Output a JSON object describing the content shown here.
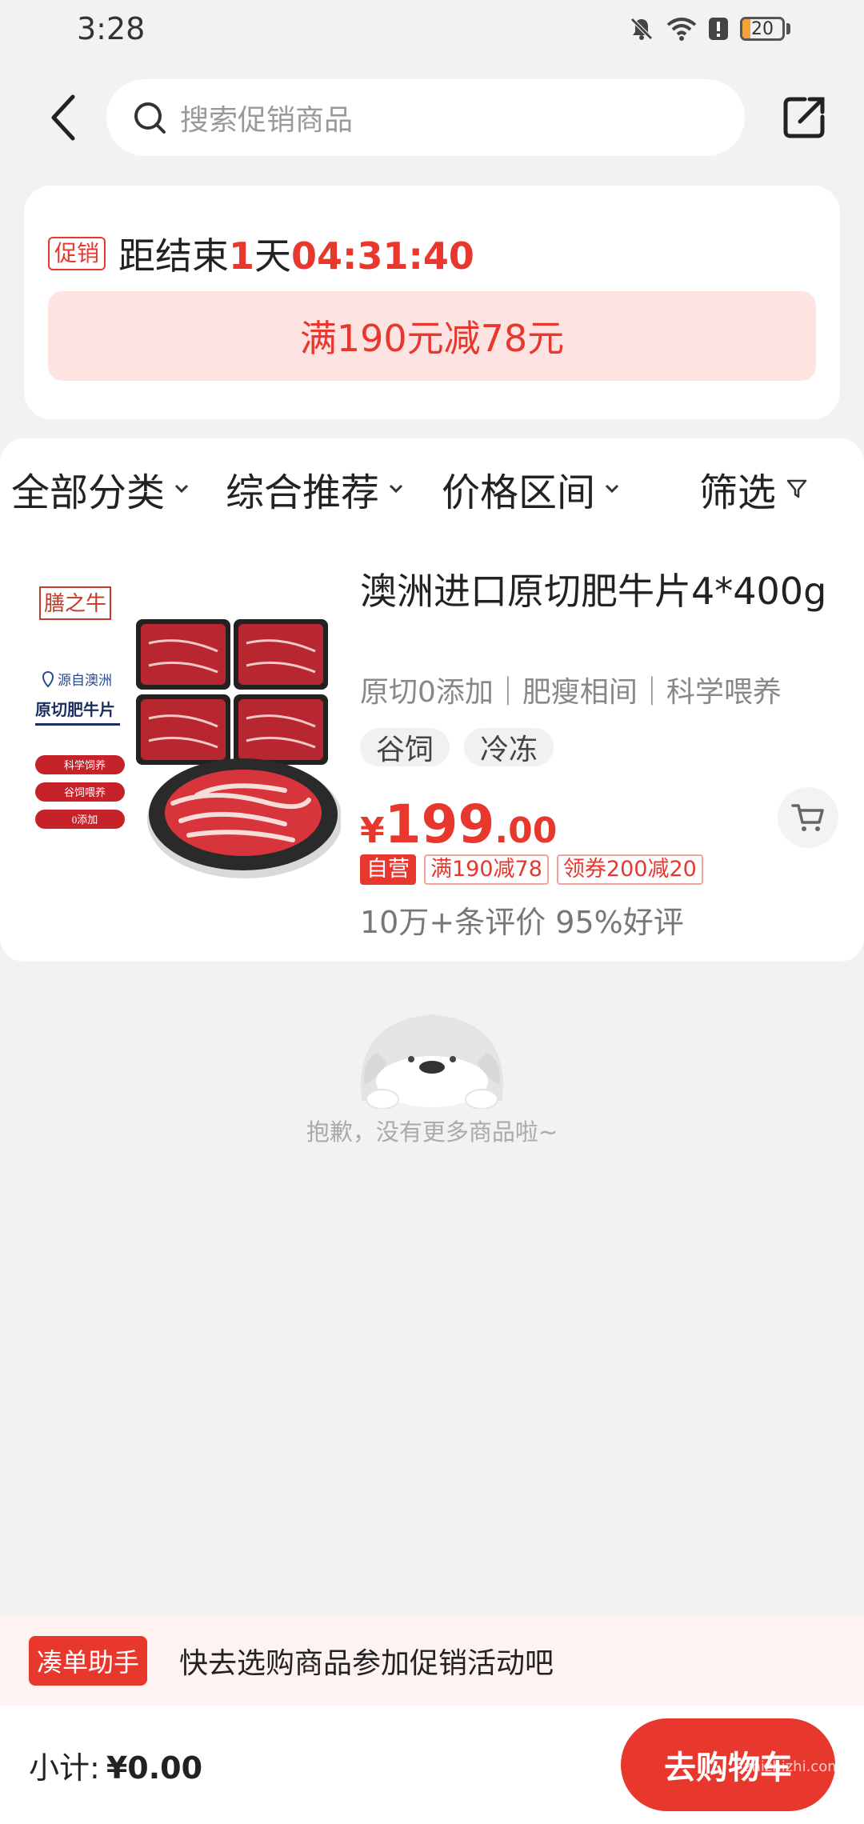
{
  "status_bar": {
    "time": "3:28",
    "battery": "20"
  },
  "header": {
    "search_placeholder": "搜索促销商品"
  },
  "promo": {
    "badge": "促销",
    "countdown_prefix": "距结束",
    "days": "1",
    "days_unit": "天",
    "time_left": "04:31:40",
    "rule": "满190元减78元"
  },
  "filters": {
    "items": [
      {
        "label": "全部分类"
      },
      {
        "label": "综合推荐"
      },
      {
        "label": "价格区间"
      },
      {
        "label": "筛选"
      }
    ]
  },
  "product": {
    "image": {
      "brand": "膳之牛",
      "origin": "源自澳洲",
      "name": "原切肥牛片",
      "features": [
        "科学饲养",
        "谷饲喂养",
        "0添加"
      ]
    },
    "title": "澳洲进口原切肥牛片4*400g",
    "subtitle": "原切0添加｜肥瘦相间｜科学喂养",
    "tags": [
      "谷饲",
      "冷冻"
    ],
    "price_currency": "¥",
    "price_int": "199",
    "price_dec": ".00",
    "labels": [
      "自营",
      "满190减78",
      "领券200减20"
    ],
    "reviews": "10万+条评价  95%好评"
  },
  "empty": {
    "text": "抱歉，没有更多商品啦~"
  },
  "helper": {
    "badge": "凑单助手",
    "text": "快去选购商品参加促销活动吧"
  },
  "bottom": {
    "subtotal_label": "小计:",
    "subtotal_value": "¥0.00",
    "cta": "去购物车"
  },
  "watermark": "zhizhizhi.com",
  "colors": {
    "accent": "#e8372d",
    "background": "#f2f2f2"
  }
}
